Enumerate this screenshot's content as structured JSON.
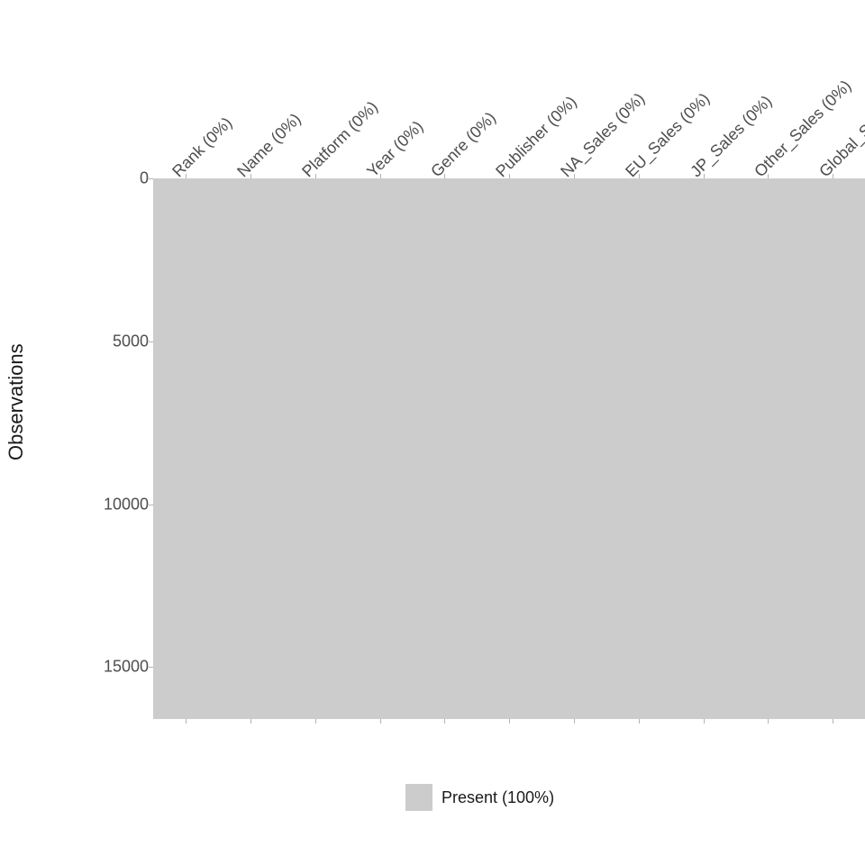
{
  "chart_data": {
    "type": "heatmap",
    "title": "",
    "xlabel": "",
    "ylabel": "Observations",
    "ylim": [
      0,
      16598
    ],
    "y_ticks": [
      0,
      5000,
      10000,
      15000
    ],
    "categories": [
      "Rank (0%)",
      "Name (0%)",
      "Platform (0%)",
      "Year (0%)",
      "Genre (0%)",
      "Publisher (0%)",
      "NA_Sales (0%)",
      "EU_Sales (0%)",
      "JP_Sales (0%)",
      "Other_Sales (0%)",
      "Global_S"
    ],
    "series": [
      {
        "name": "Present (100%)",
        "color": "#cccccc",
        "values": [
          100,
          100,
          100,
          100,
          100,
          100,
          100,
          100,
          100,
          100,
          100
        ]
      }
    ],
    "legend": "Present (100%)"
  }
}
